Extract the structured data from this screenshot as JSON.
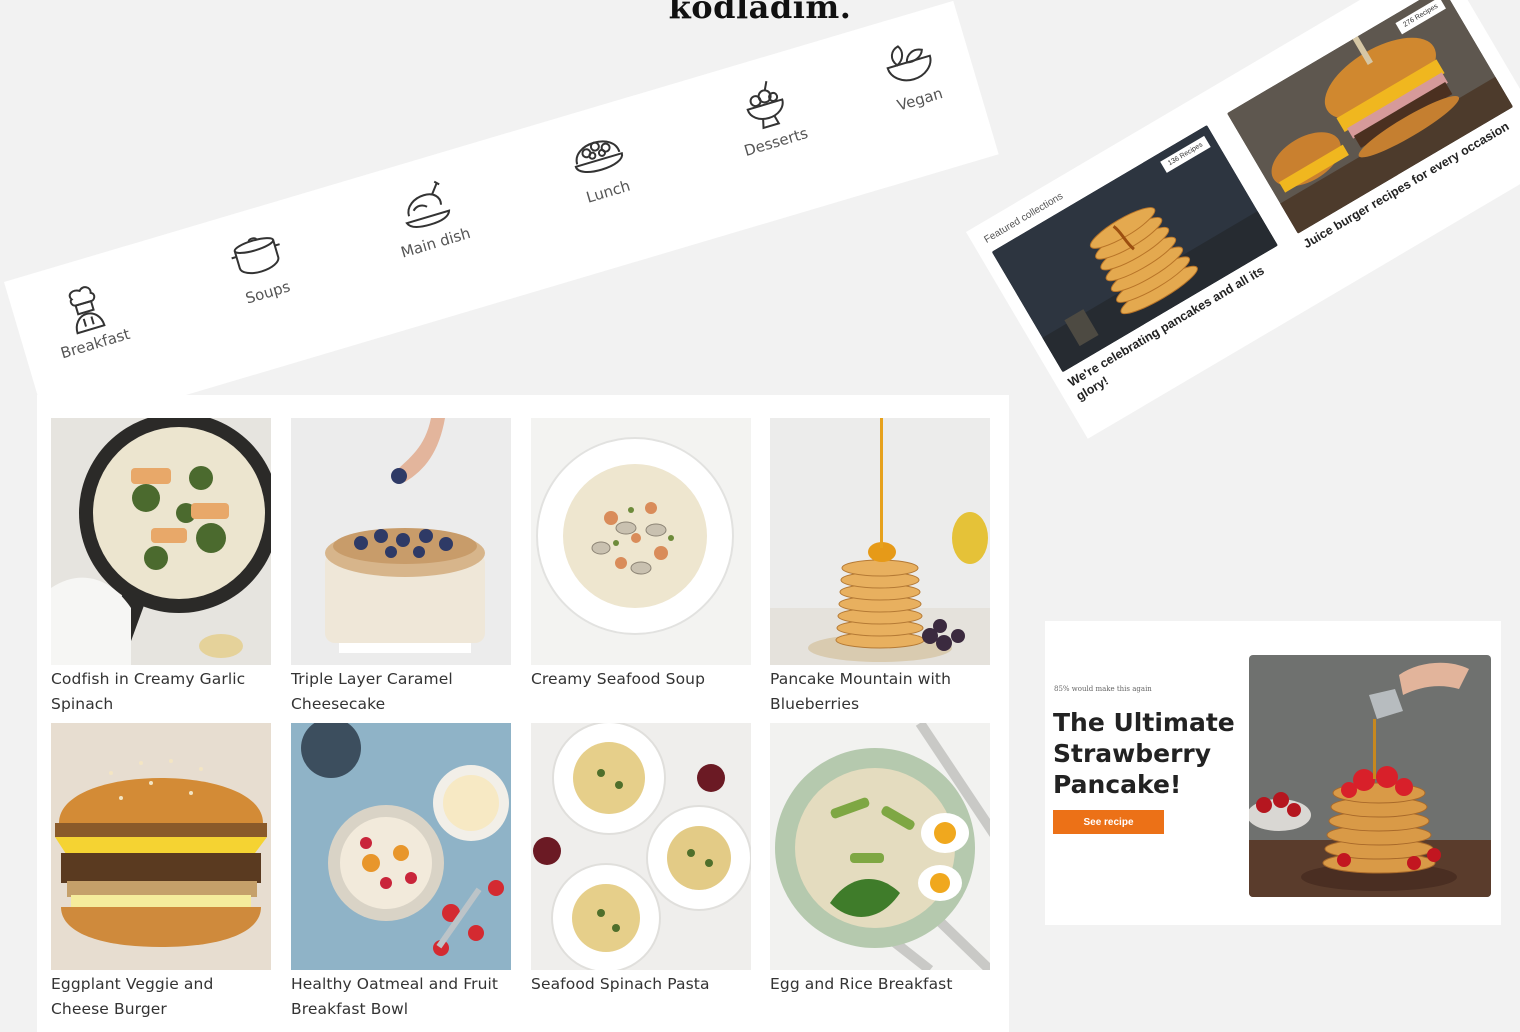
{
  "title": "kodladım.",
  "categories": [
    {
      "label": "Breakfast",
      "icon": "chef-icon"
    },
    {
      "label": "Soups",
      "icon": "pot-icon"
    },
    {
      "label": "Main dish",
      "icon": "roast-chicken-icon"
    },
    {
      "label": "Lunch",
      "icon": "casserole-icon"
    },
    {
      "label": "Desserts",
      "icon": "dessert-bowl-icon"
    },
    {
      "label": "Vegan",
      "icon": "salad-bowl-icon"
    }
  ],
  "featured": {
    "heading": "Featured collections",
    "cards": [
      {
        "badge": "136 Recipes",
        "caption": "We're celebrating pancakes and all its glory!"
      },
      {
        "badge": "276 Recipes",
        "caption": "Juice burger recipes for every occasion"
      }
    ]
  },
  "recipes": [
    {
      "title": "Codfish in Creamy Garlic Spinach"
    },
    {
      "title": "Triple Layer Caramel Cheesecake"
    },
    {
      "title": "Creamy Seafood Soup"
    },
    {
      "title": "Pancake Mountain with Blueberries"
    },
    {
      "title": "Eggplant Veggie and Cheese Burger"
    },
    {
      "title": "Healthy Oatmeal and Fruit Breakfast Bowl"
    },
    {
      "title": "Seafood Spinach Pasta"
    },
    {
      "title": "Egg and Rice Breakfast"
    }
  ],
  "hero": {
    "rating": "85% would make this again",
    "title": "The Ultimate Strawberry Pancake!",
    "button": "See recipe"
  },
  "colors": {
    "accent": "#ec7117",
    "background": "#f2f2f2"
  }
}
